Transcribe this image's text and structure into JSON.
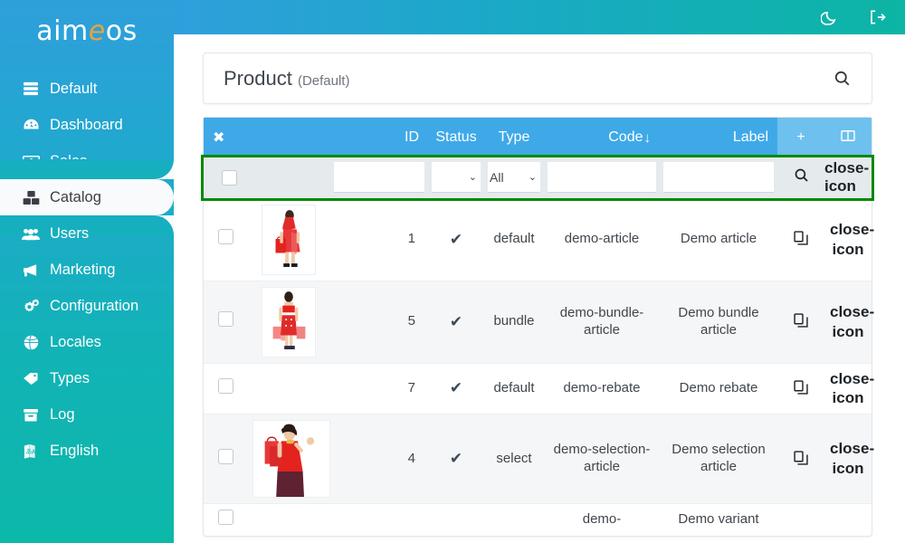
{
  "brand": {
    "text_before": "aim",
    "text_e": "e",
    "text_after": "os"
  },
  "sidebar": {
    "items": [
      {
        "label": "Default",
        "icon": "server-icon",
        "active": false
      },
      {
        "label": "Dashboard",
        "icon": "dashboard-icon",
        "active": false
      },
      {
        "label": "Sales",
        "icon": "banknote-icon",
        "active": false
      },
      {
        "label": "Catalog",
        "icon": "boxes-icon",
        "active": true
      },
      {
        "label": "Users",
        "icon": "users-icon",
        "active": false
      },
      {
        "label": "Marketing",
        "icon": "megaphone-icon",
        "active": false
      },
      {
        "label": "Configuration",
        "icon": "gears-icon",
        "active": false
      },
      {
        "label": "Locales",
        "icon": "globe-icon",
        "active": false
      },
      {
        "label": "Types",
        "icon": "tag-icon",
        "active": false
      },
      {
        "label": "Log",
        "icon": "archive-icon",
        "active": false
      },
      {
        "label": "English",
        "icon": "language-icon",
        "active": false
      }
    ]
  },
  "topbar": {
    "dark_mode_icon": "moon-icon",
    "logout_icon": "logout-icon"
  },
  "page": {
    "title": "Product",
    "subtitle": "(Default)",
    "search_icon": "search-icon"
  },
  "table": {
    "headers": {
      "select_all": "✖",
      "image": "",
      "id": "ID",
      "status": "Status",
      "type": "Type",
      "code": "Code",
      "code_sort": "↓",
      "label": "Label",
      "add": "+",
      "columns_icon": "columns-icon"
    },
    "filter": {
      "select_all_checkbox": "",
      "id_value": "",
      "id_placeholder": "",
      "status_value": "",
      "type_value": "All",
      "code_value": "",
      "code_placeholder": "",
      "label_value": "",
      "label_placeholder": "",
      "search_icon": "search-icon",
      "clear_icon": "close-icon"
    },
    "rows": [
      {
        "id": "1",
        "status": "✔",
        "type": "default",
        "code": "demo-article",
        "label": "Demo article",
        "image": "woman-red-dress-one-bag",
        "has_image": true,
        "copy_icon": "copy-icon",
        "delete_icon": "close-icon"
      },
      {
        "id": "5",
        "status": "✔",
        "type": "bundle",
        "code": "demo-bundle-article",
        "label": "Demo bundle article",
        "image": "woman-red-dress-many-bags",
        "has_image": true,
        "copy_icon": "copy-icon",
        "delete_icon": "close-icon"
      },
      {
        "id": "7",
        "status": "✔",
        "type": "default",
        "code": "demo-rebate",
        "label": "Demo rebate",
        "image": "",
        "has_image": false,
        "copy_icon": "copy-icon",
        "delete_icon": "close-icon"
      },
      {
        "id": "4",
        "status": "✔",
        "type": "select",
        "code": "demo-selection-article",
        "label": "Demo selection article",
        "image": "woman-red-top-bags",
        "has_image": true,
        "copy_icon": "copy-icon",
        "delete_icon": "close-icon"
      },
      {
        "id": "",
        "status": "",
        "type": "",
        "code": "demo-",
        "label": "Demo variant",
        "image": "",
        "has_image": false,
        "copy_icon": "",
        "delete_icon": ""
      }
    ]
  },
  "colors": {
    "sidebar_top": "#2f9fdc",
    "sidebar_bottom": "#0cb8a8",
    "header_blue": "#3fa9e8",
    "header_blue_light": "#6ec0ee",
    "filter_border_green": "#008a00",
    "filter_bg": "#e5eaed",
    "row_alt_bg": "#f5f6f7",
    "brand_accent": "#e8a33d",
    "text_dark": "#40464d"
  }
}
